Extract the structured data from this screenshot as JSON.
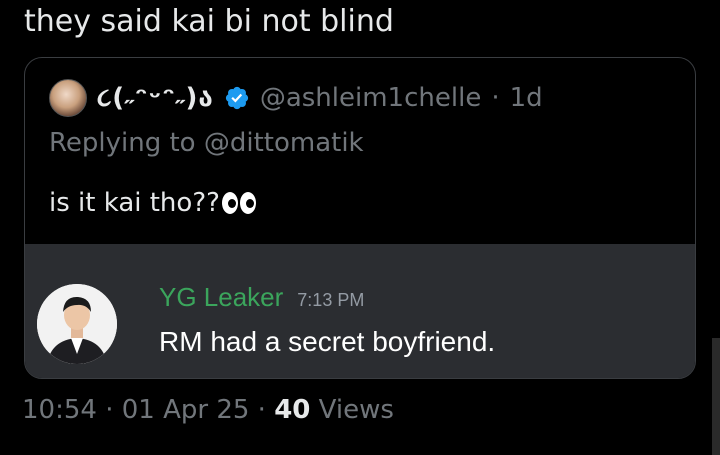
{
  "tweet": {
    "text": "they said kai bi not blind",
    "meta": {
      "time": "10:54",
      "sep1": " · ",
      "date": "01 Apr 25",
      "sep2": " · ",
      "views_count": "40",
      "views_label": " Views"
    }
  },
  "quote": {
    "display_name": "૮(˶ᵔᵕᵔ˶)ა",
    "handle": "@ashleim1chelle",
    "dot": "·",
    "age": "1d",
    "replying_prefix": "Replying to ",
    "replying_mention": "@dittomatik",
    "body": "is it kai tho??",
    "verified_color": "#1d9bf0"
  },
  "embed": {
    "name": "YG Leaker",
    "time": "7:13 PM",
    "message": "RM had a secret boyfriend.",
    "name_color": "#3ba55c"
  },
  "icons": {
    "verified": "verified-badge-icon",
    "eyes": "eyes-emoji-icon"
  }
}
